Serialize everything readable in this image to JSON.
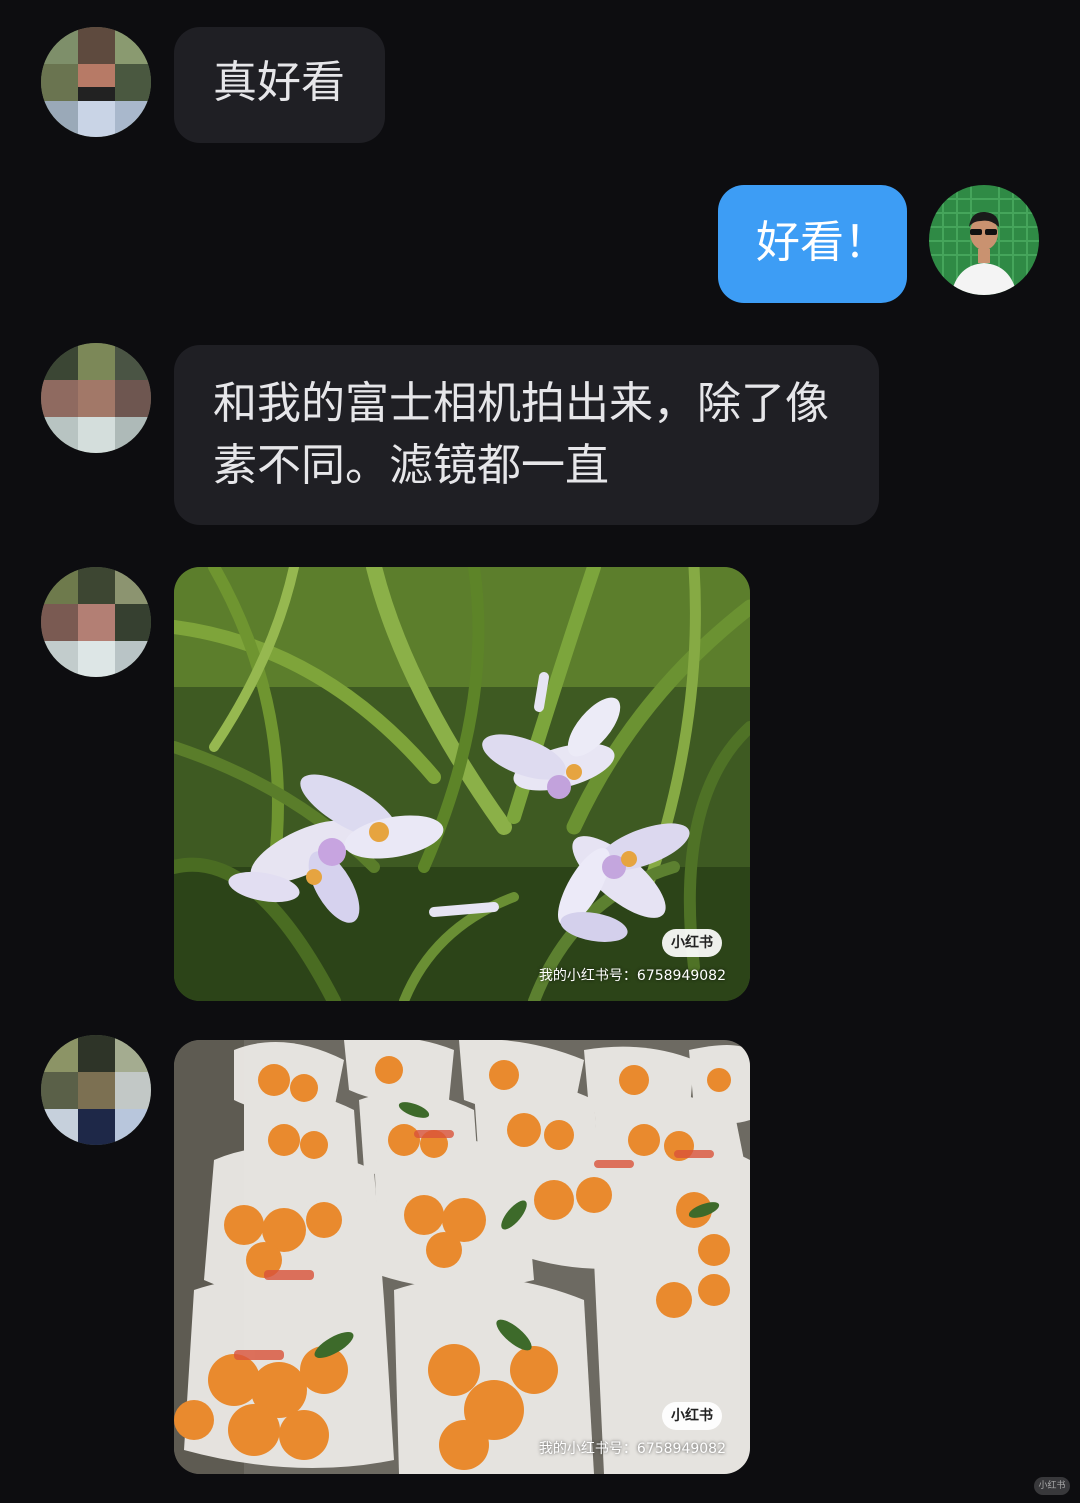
{
  "messages": [
    {
      "id": "m1",
      "side": "incoming",
      "type": "text",
      "text": "真好看"
    },
    {
      "id": "m2",
      "side": "outgoing",
      "type": "text",
      "text": "好看！"
    },
    {
      "id": "m3",
      "side": "incoming",
      "type": "text",
      "lines": [
        "和我的富士相机拍出来，除了像",
        "素不同。滤镜都一直"
      ]
    },
    {
      "id": "m4",
      "side": "incoming",
      "type": "image",
      "subject": "white-iris-flowers-photo",
      "watermark": {
        "badge": "小红书",
        "text": "我的小红书号：6758949082"
      }
    },
    {
      "id": "m5",
      "side": "incoming",
      "type": "image",
      "subject": "oranges-in-bags-photo",
      "watermark": {
        "badge": "小红书",
        "text": "我的小红书号：6758949082"
      }
    }
  ],
  "corner_logo": "小红书",
  "colors": {
    "background": "#0d0d10",
    "incoming_bubble": "#1f1f24",
    "outgoing_bubble": "#3d9df5",
    "text": "#e6e6e9"
  }
}
